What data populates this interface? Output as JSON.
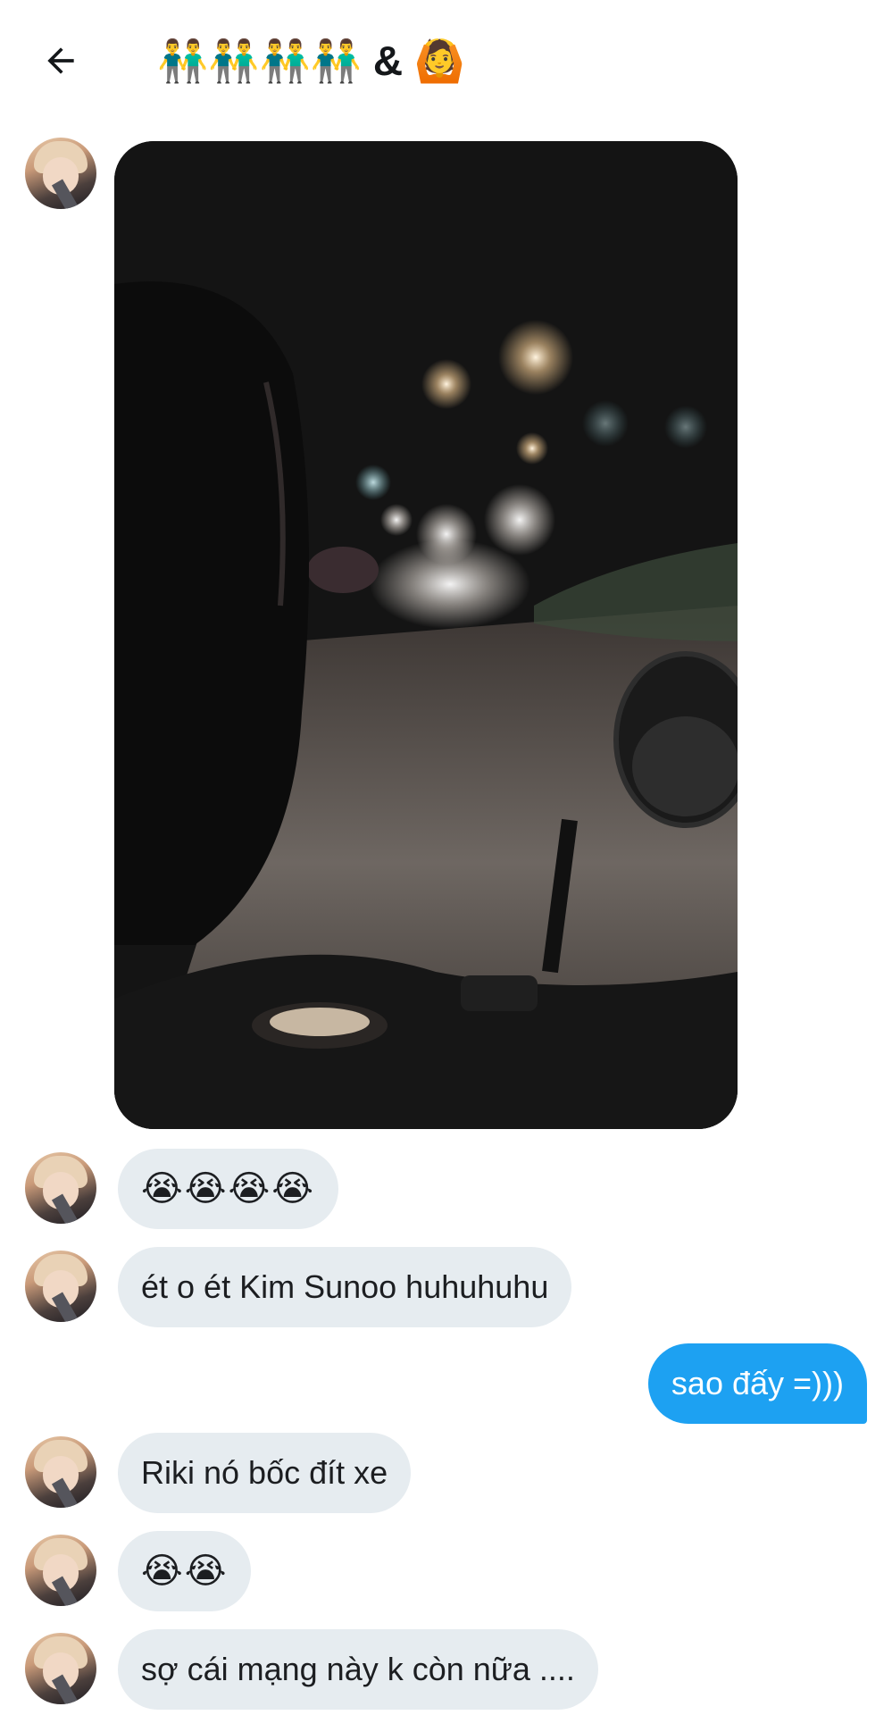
{
  "header": {
    "back_icon": "arrow-left-icon",
    "title": "👬👬👬👬 & 🙆"
  },
  "conversation": {
    "messages": [
      {
        "sender": "other",
        "type": "image",
        "icon": "photo-night-road"
      },
      {
        "sender": "other",
        "text": "😭😭😭😭"
      },
      {
        "sender": "other",
        "text": "ét o ét Kim Sunoo huhuhuhu"
      },
      {
        "sender": "me",
        "text": "sao đấy =)))"
      },
      {
        "sender": "other",
        "text": "Riki nó bốc đít xe"
      },
      {
        "sender": "other",
        "text": "😭😭"
      },
      {
        "sender": "other",
        "text": "sợ cái mạng này k còn nữa ...."
      }
    ]
  },
  "colors": {
    "my_bubble": "#1da1f2",
    "their_bubble": "#e6ecf0",
    "background": "#ffffff"
  }
}
